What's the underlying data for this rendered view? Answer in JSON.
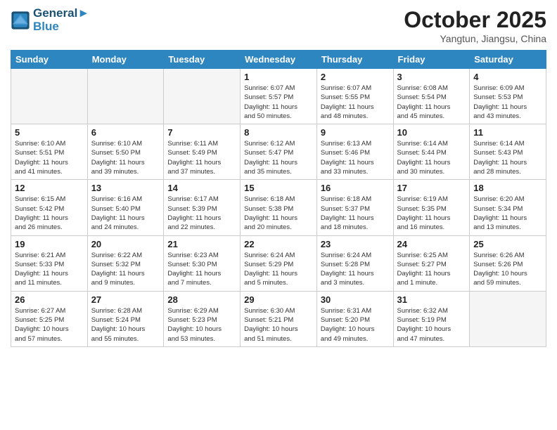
{
  "header": {
    "logo_line1": "General",
    "logo_line2": "Blue",
    "month": "October 2025",
    "location": "Yangtun, Jiangsu, China"
  },
  "weekdays": [
    "Sunday",
    "Monday",
    "Tuesday",
    "Wednesday",
    "Thursday",
    "Friday",
    "Saturday"
  ],
  "weeks": [
    [
      {
        "day": "",
        "info": ""
      },
      {
        "day": "",
        "info": ""
      },
      {
        "day": "",
        "info": ""
      },
      {
        "day": "1",
        "info": "Sunrise: 6:07 AM\nSunset: 5:57 PM\nDaylight: 11 hours\nand 50 minutes."
      },
      {
        "day": "2",
        "info": "Sunrise: 6:07 AM\nSunset: 5:55 PM\nDaylight: 11 hours\nand 48 minutes."
      },
      {
        "day": "3",
        "info": "Sunrise: 6:08 AM\nSunset: 5:54 PM\nDaylight: 11 hours\nand 45 minutes."
      },
      {
        "day": "4",
        "info": "Sunrise: 6:09 AM\nSunset: 5:53 PM\nDaylight: 11 hours\nand 43 minutes."
      }
    ],
    [
      {
        "day": "5",
        "info": "Sunrise: 6:10 AM\nSunset: 5:51 PM\nDaylight: 11 hours\nand 41 minutes."
      },
      {
        "day": "6",
        "info": "Sunrise: 6:10 AM\nSunset: 5:50 PM\nDaylight: 11 hours\nand 39 minutes."
      },
      {
        "day": "7",
        "info": "Sunrise: 6:11 AM\nSunset: 5:49 PM\nDaylight: 11 hours\nand 37 minutes."
      },
      {
        "day": "8",
        "info": "Sunrise: 6:12 AM\nSunset: 5:47 PM\nDaylight: 11 hours\nand 35 minutes."
      },
      {
        "day": "9",
        "info": "Sunrise: 6:13 AM\nSunset: 5:46 PM\nDaylight: 11 hours\nand 33 minutes."
      },
      {
        "day": "10",
        "info": "Sunrise: 6:14 AM\nSunset: 5:44 PM\nDaylight: 11 hours\nand 30 minutes."
      },
      {
        "day": "11",
        "info": "Sunrise: 6:14 AM\nSunset: 5:43 PM\nDaylight: 11 hours\nand 28 minutes."
      }
    ],
    [
      {
        "day": "12",
        "info": "Sunrise: 6:15 AM\nSunset: 5:42 PM\nDaylight: 11 hours\nand 26 minutes."
      },
      {
        "day": "13",
        "info": "Sunrise: 6:16 AM\nSunset: 5:40 PM\nDaylight: 11 hours\nand 24 minutes."
      },
      {
        "day": "14",
        "info": "Sunrise: 6:17 AM\nSunset: 5:39 PM\nDaylight: 11 hours\nand 22 minutes."
      },
      {
        "day": "15",
        "info": "Sunrise: 6:18 AM\nSunset: 5:38 PM\nDaylight: 11 hours\nand 20 minutes."
      },
      {
        "day": "16",
        "info": "Sunrise: 6:18 AM\nSunset: 5:37 PM\nDaylight: 11 hours\nand 18 minutes."
      },
      {
        "day": "17",
        "info": "Sunrise: 6:19 AM\nSunset: 5:35 PM\nDaylight: 11 hours\nand 16 minutes."
      },
      {
        "day": "18",
        "info": "Sunrise: 6:20 AM\nSunset: 5:34 PM\nDaylight: 11 hours\nand 13 minutes."
      }
    ],
    [
      {
        "day": "19",
        "info": "Sunrise: 6:21 AM\nSunset: 5:33 PM\nDaylight: 11 hours\nand 11 minutes."
      },
      {
        "day": "20",
        "info": "Sunrise: 6:22 AM\nSunset: 5:32 PM\nDaylight: 11 hours\nand 9 minutes."
      },
      {
        "day": "21",
        "info": "Sunrise: 6:23 AM\nSunset: 5:30 PM\nDaylight: 11 hours\nand 7 minutes."
      },
      {
        "day": "22",
        "info": "Sunrise: 6:24 AM\nSunset: 5:29 PM\nDaylight: 11 hours\nand 5 minutes."
      },
      {
        "day": "23",
        "info": "Sunrise: 6:24 AM\nSunset: 5:28 PM\nDaylight: 11 hours\nand 3 minutes."
      },
      {
        "day": "24",
        "info": "Sunrise: 6:25 AM\nSunset: 5:27 PM\nDaylight: 11 hours\nand 1 minute."
      },
      {
        "day": "25",
        "info": "Sunrise: 6:26 AM\nSunset: 5:26 PM\nDaylight: 10 hours\nand 59 minutes."
      }
    ],
    [
      {
        "day": "26",
        "info": "Sunrise: 6:27 AM\nSunset: 5:25 PM\nDaylight: 10 hours\nand 57 minutes."
      },
      {
        "day": "27",
        "info": "Sunrise: 6:28 AM\nSunset: 5:24 PM\nDaylight: 10 hours\nand 55 minutes."
      },
      {
        "day": "28",
        "info": "Sunrise: 6:29 AM\nSunset: 5:23 PM\nDaylight: 10 hours\nand 53 minutes."
      },
      {
        "day": "29",
        "info": "Sunrise: 6:30 AM\nSunset: 5:21 PM\nDaylight: 10 hours\nand 51 minutes."
      },
      {
        "day": "30",
        "info": "Sunrise: 6:31 AM\nSunset: 5:20 PM\nDaylight: 10 hours\nand 49 minutes."
      },
      {
        "day": "31",
        "info": "Sunrise: 6:32 AM\nSunset: 5:19 PM\nDaylight: 10 hours\nand 47 minutes."
      },
      {
        "day": "",
        "info": ""
      }
    ]
  ]
}
